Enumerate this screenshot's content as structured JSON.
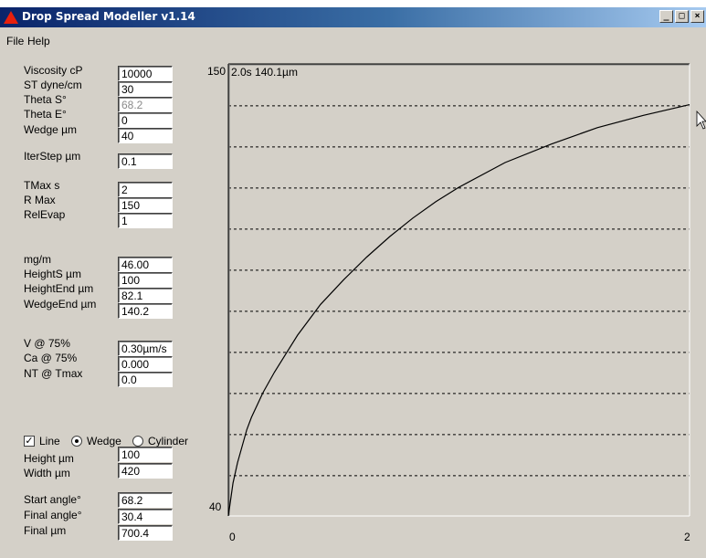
{
  "window": {
    "title": "Drop Spread Modeller v1.14",
    "controls": [
      "_",
      "□",
      "×"
    ]
  },
  "menu": [
    "File",
    "Help"
  ],
  "inputs": [
    {
      "label": "Viscosity cP",
      "value": "10000"
    },
    {
      "label": "ST dyne/cm",
      "value": "30"
    },
    {
      "label": "Theta S°",
      "value": "68.2",
      "disabled": true
    },
    {
      "label": "Theta E°",
      "value": "0"
    },
    {
      "label": "Wedge µm",
      "value": "40"
    },
    {
      "label": "IterStep µm",
      "value": "0.1"
    },
    {
      "label": "TMax s",
      "value": "2"
    },
    {
      "label": "R Max",
      "value": "150"
    },
    {
      "label": "RelEvap",
      "value": "1"
    },
    {
      "label": "mg/m",
      "value": "46.00"
    },
    {
      "label": "HeightS µm",
      "value": "100"
    },
    {
      "label": "HeightEnd µm",
      "value": "82.1"
    },
    {
      "label": "WedgeEnd µm",
      "value": "140.2"
    },
    {
      "label": "V @ 75%",
      "value": "0.30µm/s"
    },
    {
      "label": "Ca @ 75%",
      "value": "0.000"
    },
    {
      "label": "NT @ Tmax",
      "value": "0.0"
    },
    {
      "label": "Height µm",
      "value": "100"
    },
    {
      "label": "Width µm",
      "value": "420"
    },
    {
      "label": "Start angle°",
      "value": "68.2"
    },
    {
      "label": "Final angle°",
      "value": "30.4"
    },
    {
      "label": "Final µm",
      "value": "700.4"
    }
  ],
  "options": {
    "line": {
      "label": "Line",
      "checked": true
    },
    "shape": [
      {
        "label": "Wedge",
        "selected": true
      },
      {
        "label": "Cylinder",
        "selected": false
      }
    ]
  },
  "chart_data": {
    "type": "line",
    "readout": "2.0s 140.1µm",
    "xlim": [
      0,
      2
    ],
    "ylim": [
      40,
      150
    ],
    "x_tick_labels": [
      "0",
      "2"
    ],
    "y_tick_labels": [
      "40",
      "150"
    ],
    "gridlines_y": [
      49.8,
      59.8,
      69.8,
      79.8,
      89.8,
      99.8,
      109.8,
      119.8,
      129.8,
      139.8
    ],
    "grid": "dashed horizontal",
    "series": [
      {
        "x": [
          0,
          0.02,
          0.04,
          0.08,
          0.1,
          0.15,
          0.2,
          0.3,
          0.4,
          0.5,
          0.6,
          0.7,
          0.8,
          0.9,
          1.0,
          1.2,
          1.4,
          1.6,
          1.8,
          2.0
        ],
        "values": [
          40,
          48.0,
          53.0,
          61.0,
          64.0,
          70.0,
          75.0,
          84.0,
          91.5,
          97.5,
          103.0,
          108.0,
          112.5,
          116.5,
          120.0,
          126.0,
          130.5,
          134.5,
          137.5,
          140.1
        ]
      }
    ]
  }
}
